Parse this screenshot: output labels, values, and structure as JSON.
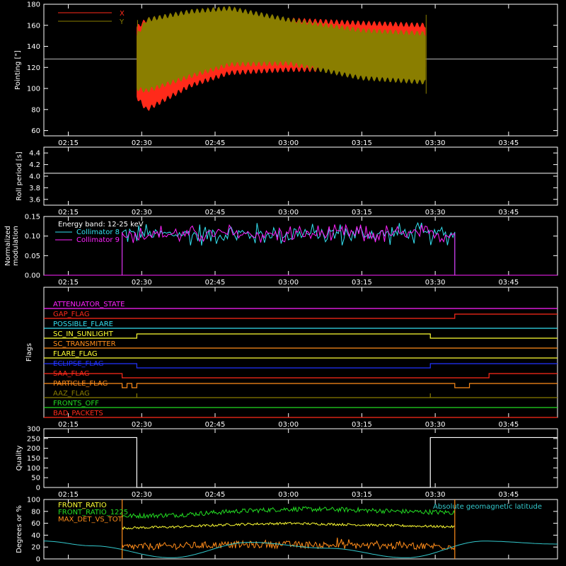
{
  "colors": {
    "background": "#000000",
    "axes": "#ffffff",
    "red": "#ff2a1a",
    "olive": "#8a7e00",
    "cyan": "#33e0f0",
    "magenta": "#ff22ff",
    "green": "#22dd22",
    "yellow": "#ffff33",
    "orange": "#ff8c1a",
    "blue": "#2233ff",
    "darkred": "#dd1111",
    "geocyan": "#33c8cc"
  },
  "time_ticks": [
    "02:15",
    "02:30",
    "02:45",
    "03:00",
    "03:15",
    "03:30",
    "03:45"
  ],
  "chart_data": [
    {
      "type": "line",
      "panel": "pointing",
      "ylabel": "Pointing [\"]",
      "ylim": [
        55,
        180
      ],
      "yticks": [
        "60",
        "80",
        "100",
        "120",
        "140",
        "160",
        "180"
      ],
      "xlim": [
        "02:10",
        "03:55"
      ],
      "reference_line": 128,
      "legend": [
        "X",
        "Y"
      ],
      "series": [
        {
          "name": "X",
          "x": [
            "02:29",
            "02:31",
            "02:40",
            "02:48",
            "03:00",
            "03:15",
            "03:28"
          ],
          "upper": [
            158,
            165,
            172,
            170,
            165,
            162,
            160
          ],
          "lower": [
            92,
            80,
            103,
            115,
            118,
            118,
            118
          ]
        },
        {
          "name": "Y",
          "x": [
            "02:29",
            "02:31",
            "02:40",
            "02:48",
            "03:00",
            "03:15",
            "03:28"
          ],
          "upper": [
            150,
            165,
            173,
            176,
            165,
            155,
            152
          ],
          "lower": [
            100,
            98,
            112,
            123,
            124,
            110,
            106
          ]
        }
      ]
    },
    {
      "type": "line",
      "panel": "roll",
      "ylabel": "Roll period [s]",
      "ylim": [
        3.5,
        4.5
      ],
      "yticks": [
        "3.6",
        "3.8",
        "4.0",
        "4.2",
        "4.4"
      ],
      "series": [
        {
          "x": [
            "02:10",
            "03:55"
          ],
          "values": [
            4.05,
            4.05
          ]
        }
      ]
    },
    {
      "type": "line",
      "panel": "modulation",
      "ylabel_lines": [
        "Normalized",
        "modulation"
      ],
      "ylim": [
        0,
        0.15
      ],
      "yticks": [
        "0.00",
        "0.05",
        "0.10",
        "0.15"
      ],
      "legend": [
        "Energy band: 12-25 keV",
        "Collimator 8",
        "Collimator 9"
      ],
      "series": [
        {
          "name": "Collimator 8",
          "x_start": "02:26",
          "x_end": "03:34",
          "mean": 0.105,
          "spread": 0.03
        },
        {
          "name": "Collimator 9",
          "x_start": "02:26",
          "x_end": "03:34",
          "mean": 0.105,
          "spread": 0.025
        }
      ]
    },
    {
      "type": "line",
      "panel": "flags",
      "ylabel": "Flags",
      "flags": [
        {
          "name": "ATTENUATOR_STATE",
          "color": "magenta",
          "steps": []
        },
        {
          "name": "GAP_FLAG",
          "color": "red",
          "steps": [
            [
              "03:34",
              1
            ]
          ]
        },
        {
          "name": "POSSIBLE_FLARE",
          "color": "cyan",
          "steps": []
        },
        {
          "name": "SC_IN_SUNLIGHT",
          "color": "yellow",
          "steps": [
            [
              "02:29",
              1
            ],
            [
              "03:29",
              0
            ]
          ]
        },
        {
          "name": "SC_TRANSMITTER",
          "color": "orange",
          "steps": []
        },
        {
          "name": "FLARE_FLAG",
          "color": "yellow",
          "steps": []
        },
        {
          "name": "ECLIPSE_FLAG",
          "color": "blue",
          "steps": [
            [
              "02:29",
              0
            ],
            [
              "03:29",
              1
            ]
          ]
        },
        {
          "name": "SAA_FLAG",
          "color": "red",
          "steps": [
            [
              "02:26",
              0
            ],
            [
              "03:41",
              1
            ]
          ]
        },
        {
          "name": "PARTICLE_FLAG",
          "color": "orange",
          "steps": [
            [
              "02:26",
              0
            ],
            [
              "02:27",
              1
            ],
            [
              "02:28",
              0
            ],
            [
              "02:29",
              1
            ],
            [
              "03:34",
              0
            ],
            [
              "03:37",
              1
            ]
          ]
        },
        {
          "name": "AAZ_FLAG",
          "color": "olive",
          "steps": [
            [
              "02:29",
              1
            ],
            [
              "02:29",
              0
            ],
            [
              "03:29",
              1
            ],
            [
              "03:29",
              0
            ]
          ]
        },
        {
          "name": "FRONTS_OFF",
          "color": "green",
          "steps": []
        },
        {
          "name": "BAD_PACKETS",
          "color": "red",
          "steps": []
        }
      ]
    },
    {
      "type": "line",
      "panel": "quality",
      "ylabel": "Quality",
      "ylim": [
        0,
        300
      ],
      "yticks": [
        "0",
        "50",
        "100",
        "150",
        "200",
        "250",
        "300"
      ],
      "series": [
        {
          "x": [
            "02:10",
            "02:29",
            "02:29",
            "03:29",
            "03:29",
            "03:55"
          ],
          "values": [
            255,
            255,
            0,
            0,
            255,
            255
          ]
        }
      ]
    },
    {
      "type": "line",
      "panel": "ratios",
      "ylabel": "Degrees or %",
      "ylim": [
        0,
        100
      ],
      "yticks": [
        "0",
        "20",
        "40",
        "60",
        "80",
        "100"
      ],
      "legend": [
        "FRONT_RATIO",
        "FRONT_RATIO_1225",
        "MAX_DET_VS_TOT",
        "Absolute geomagnetic latitude"
      ],
      "series": [
        {
          "name": "FRONT_RATIO_1225",
          "x_start": "02:26",
          "x_end": "03:34",
          "values": [
            72,
            74,
            80,
            84,
            83,
            80,
            78
          ]
        },
        {
          "name": "FRONT_RATIO",
          "x_start": "02:26",
          "x_end": "03:34",
          "values": [
            52,
            54,
            58,
            60,
            58,
            56,
            54
          ]
        },
        {
          "name": "MAX_DET_VS_TOT",
          "x_start": "02:26",
          "x_end": "03:34",
          "values": [
            20,
            22,
            24,
            24,
            23,
            22,
            21
          ]
        },
        {
          "name": "Absolute geomagnetic latitude",
          "x": [
            "02:10",
            "02:20",
            "02:36",
            "02:52",
            "03:08",
            "03:24",
            "03:40",
            "03:55"
          ],
          "values": [
            30,
            22,
            2,
            28,
            18,
            2,
            30,
            25
          ]
        }
      ]
    }
  ]
}
